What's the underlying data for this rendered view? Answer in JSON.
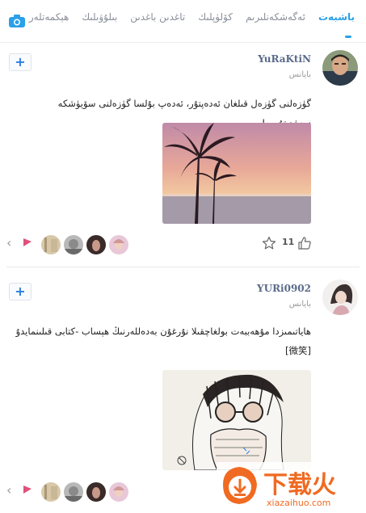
{
  "nav": {
    "tabs": [
      {
        "label": "باشبەت",
        "active": true
      },
      {
        "label": "ئەگەشكەنلىرىم",
        "active": false
      },
      {
        "label": "كۆلۈپلىك",
        "active": false
      },
      {
        "label": "تاغدىن باغدىن",
        "active": false
      },
      {
        "label": "بىلۇۋىلىك",
        "active": false
      },
      {
        "label": "ھېكمەتلەر",
        "active": false
      }
    ],
    "camera_icon": "camera-icon",
    "accent": "#2aa0e8"
  },
  "posts": [
    {
      "username": "YuRaKtiN",
      "sub": "بايانس",
      "text": "گۈزەلنى گۈزەل قىلغان ئەدەپتۇر، ئەدەپ بۇلسا گۈزەلنى سۆيۈشكە سەۋەپتۇر...!",
      "follow_label": "+",
      "like_count": "11"
    },
    {
      "username": "YURi0902",
      "sub": "بايانس",
      "text": "ھاياتىمىزدا مۇھەببەت بولغاچقىلا نۇرغۇن بەدەللەرنىڭ ھېساب -كتابى قىلىنمايدۇ [微笑]",
      "follow_label": "+",
      "like_count": ""
    }
  ],
  "watermark": {
    "title": "下载火",
    "url": "xiazaihuo.com"
  }
}
